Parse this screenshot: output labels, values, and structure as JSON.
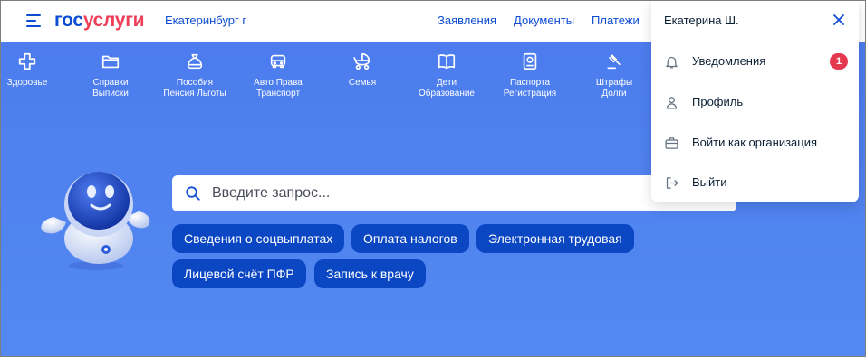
{
  "header": {
    "logo_part1": "гос",
    "logo_part2": "услуги",
    "city": "Екатеринбург г",
    "nav": [
      "Заявления",
      "Документы",
      "Платежи"
    ]
  },
  "categories": [
    {
      "line1": "Здоровье",
      "line2": "",
      "icon": "plus-cross-icon"
    },
    {
      "line1": "Справки",
      "line2": "Выписки",
      "icon": "folder-icon"
    },
    {
      "line1": "Пособия",
      "line2": "Пенсия Льготы",
      "icon": "money-bag-icon"
    },
    {
      "line1": "Авто Права",
      "line2": "Транспорт",
      "icon": "car-icon"
    },
    {
      "line1": "Семья",
      "line2": "",
      "icon": "stroller-icon"
    },
    {
      "line1": "Дети",
      "line2": "Образование",
      "icon": "open-book-icon"
    },
    {
      "line1": "Паспорта",
      "line2": "Регистрация",
      "icon": "passport-icon"
    },
    {
      "line1": "Штрафы",
      "line2": "Долги",
      "icon": "gavel-icon"
    }
  ],
  "search": {
    "placeholder": "Введите запрос..."
  },
  "chips": [
    "Сведения о соцвыплатах",
    "Оплата налогов",
    "Электронная трудовая",
    "Лицевой счёт ПФР",
    "Запись к врачу"
  ],
  "dropdown": {
    "user_name": "Екатерина Ш.",
    "items": [
      {
        "label": "Уведомления",
        "icon": "bell-icon",
        "badge": "1"
      },
      {
        "label": "Профиль",
        "icon": "person-icon"
      },
      {
        "label": "Войти как организация",
        "icon": "briefcase-icon"
      },
      {
        "label": "Выйти",
        "icon": "logout-icon"
      }
    ]
  },
  "colors": {
    "brand_blue": "#0d4cd3",
    "brand_red": "#ee3f58",
    "hero_bg": "#5389f0",
    "chip_bg": "#0b47c3",
    "badge": "#e53950"
  }
}
